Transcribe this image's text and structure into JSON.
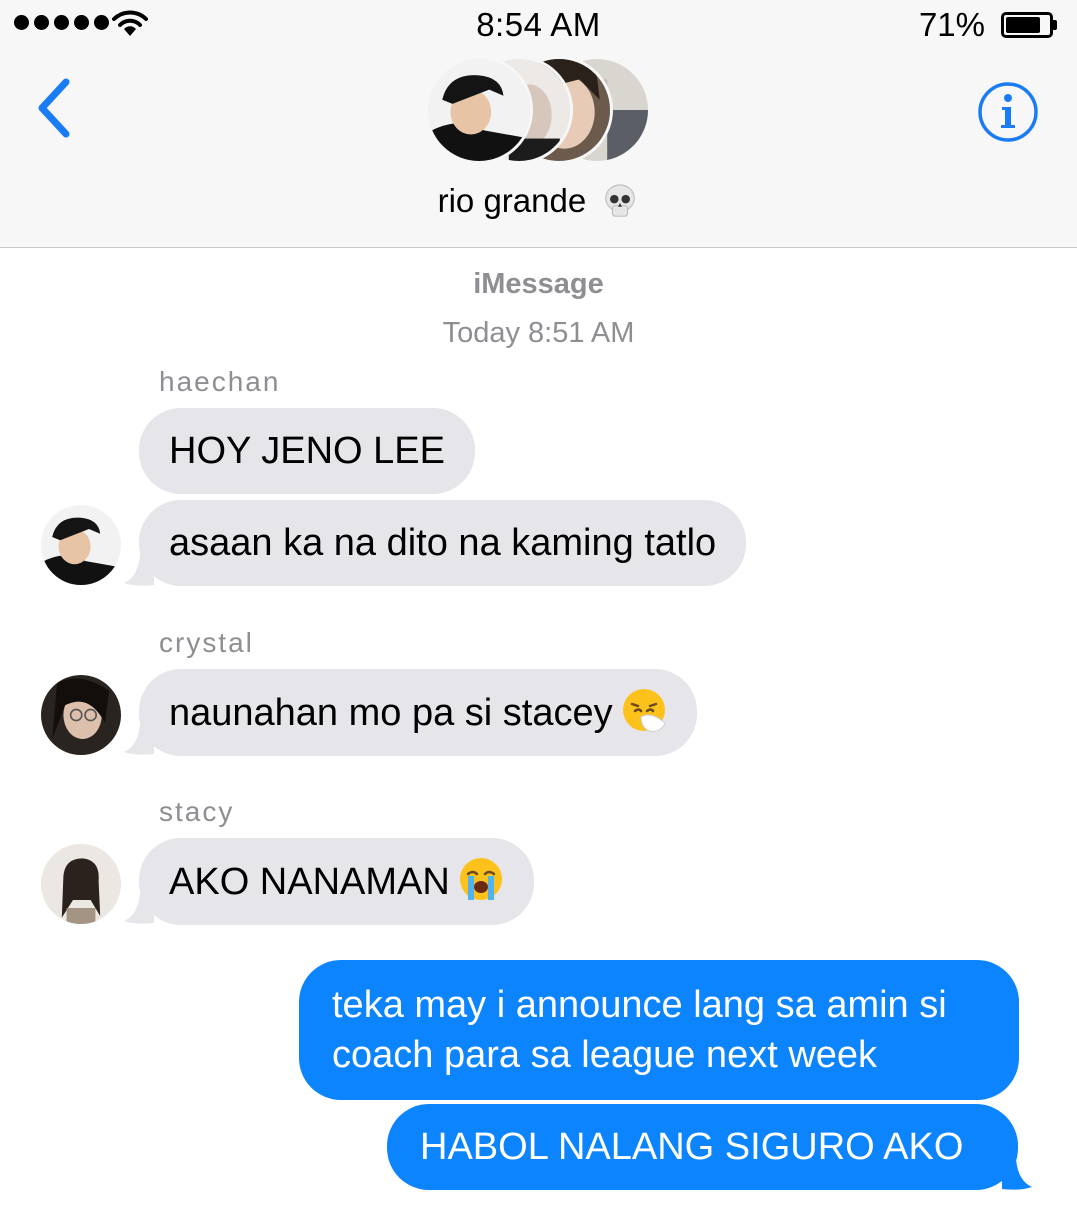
{
  "status_bar": {
    "time": "8:54 AM",
    "battery_percent": "71%",
    "signal_icon": "signal-dots-icon",
    "wifi_icon": "wifi-icon",
    "battery_icon": "battery-icon"
  },
  "header": {
    "back_icon": "chevron-left-icon",
    "info_icon": "info-icon",
    "group_name": "rio grande",
    "group_emoji": "skull-emoji"
  },
  "thread": {
    "service": "iMessage",
    "timestamp": "Today 8:51 AM"
  },
  "messages": [
    {
      "sender": "haechan",
      "text": "HOY JENO LEE",
      "direction": "incoming"
    },
    {
      "sender": "haechan",
      "text": "asaan ka na dito na kaming tatlo",
      "direction": "incoming"
    },
    {
      "sender": "crystal",
      "text": "naunahan mo pa si stacey",
      "emoji": "sneezing-face-emoji",
      "direction": "incoming"
    },
    {
      "sender": "stacy",
      "text": "AKO NANAMAN",
      "emoji": "crying-face-emoji",
      "direction": "incoming"
    },
    {
      "sender": "",
      "text_lines": [
        "teka may i announce lang sa amin si",
        "coach para sa league next week"
      ],
      "direction": "outgoing"
    },
    {
      "sender": "",
      "text": "HABOL NALANG SIGURO AKO",
      "direction": "outgoing"
    }
  ],
  "colors": {
    "outgoing_bubble": "#0b84fe",
    "incoming_bubble": "#e5e5ea",
    "accent": "#1a7cf5",
    "meta_text": "#8e8e93"
  }
}
